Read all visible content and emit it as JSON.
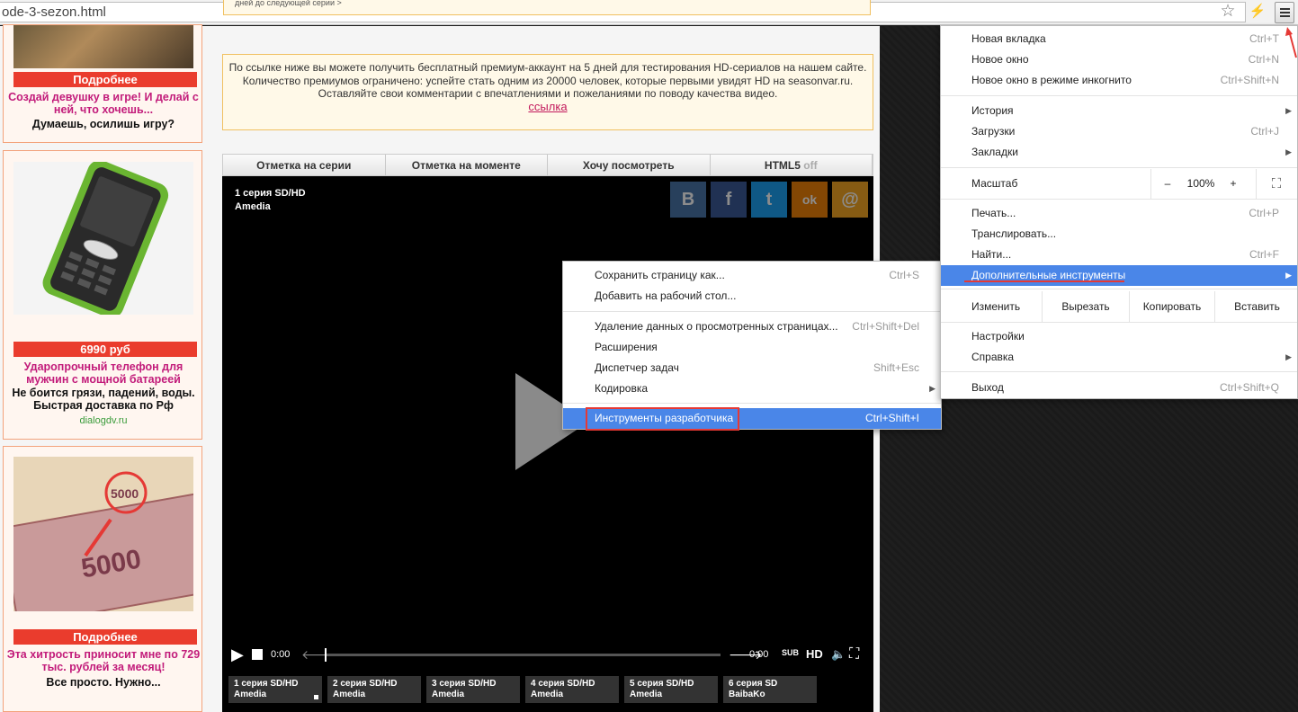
{
  "browser": {
    "url_fragment": "ode-3-sezon.html"
  },
  "ads": [
    {
      "button": "Подробнее",
      "line1": "Создай девушку в игре! И делай с ней, что хочешь...",
      "line2": "Думаешь, осилишь игру?"
    },
    {
      "price": "6990 руб",
      "line1": "Ударопрочный телефон для мужчин с мощной батареей",
      "line2": "Не боится грязи, падений, воды. Быстрая доставка по Рф",
      "domain": "dialogdv.ru"
    },
    {
      "button": "Подробнее",
      "line1": "Эта хитрость приносит мне по 729 тыс. рублей за месяц!",
      "line2": "Все просто. Нужно..."
    }
  ],
  "notice": {
    "top_cut": "дней до следующей серии >",
    "text": "По ссылке ниже вы можете получить бесплатный премиум-аккаунт на 5 дней для тестирования HD-сериалов на нашем сайте. Количество премиумов ограничено: успейте стать одним из 20000 человек, которые первыми увидят HD на seasonvar.ru.",
    "text2": "Оставляйте свои комментарии с впечатлениями и пожеланиями по поводу качества видео.",
    "link": "ссылка"
  },
  "player_tabs": [
    "Отметка на серии",
    "Отметка на моменте",
    "Хочу посмотреть",
    "HTML5"
  ],
  "player_tab_off": "off",
  "player": {
    "title1": "1 серия SD/HD",
    "title2": "Amedia",
    "time_current": "0:00",
    "time_total": "0:00",
    "sub": "SUB",
    "hd": "HD",
    "social": [
      "В",
      "f",
      "t",
      "ok",
      "@"
    ],
    "episodes": [
      {
        "title": "1 серия SD/HD",
        "studio": "Amedia"
      },
      {
        "title": "2 серия SD/HD",
        "studio": "Amedia"
      },
      {
        "title": "3 серия SD/HD",
        "studio": "Amedia"
      },
      {
        "title": "4 серия SD/HD",
        "studio": "Amedia"
      },
      {
        "title": "5 серия SD/HD",
        "studio": "Amedia"
      },
      {
        "title": "6 серия SD",
        "studio": "BaibaKo"
      }
    ]
  },
  "submenu": {
    "save": {
      "label": "Сохранить страницу как...",
      "shortcut": "Ctrl+S"
    },
    "desktop": {
      "label": "Добавить на рабочий стол..."
    },
    "clear": {
      "label": "Удаление данных о просмотренных страницах...",
      "shortcut": "Ctrl+Shift+Del"
    },
    "ext": {
      "label": "Расширения"
    },
    "tasks": {
      "label": "Диспетчер задач",
      "shortcut": "Shift+Esc"
    },
    "encoding": {
      "label": "Кодировка"
    },
    "devtools": {
      "label": "Инструменты разработчика",
      "shortcut": "Ctrl+Shift+I"
    }
  },
  "mainmenu": {
    "new_tab": {
      "label": "Новая вкладка",
      "shortcut": "Ctrl+T"
    },
    "new_window": {
      "label": "Новое окно",
      "shortcut": "Ctrl+N"
    },
    "incognito": {
      "label": "Новое окно в режиме инкогнито",
      "shortcut": "Ctrl+Shift+N"
    },
    "history": {
      "label": "История"
    },
    "downloads": {
      "label": "Загрузки",
      "shortcut": "Ctrl+J"
    },
    "bookmarks": {
      "label": "Закладки"
    },
    "zoom": {
      "label": "Масштаб",
      "minus": "–",
      "value": "100%",
      "plus": "+"
    },
    "print": {
      "label": "Печать...",
      "shortcut": "Ctrl+P"
    },
    "cast": {
      "label": "Транслировать..."
    },
    "find": {
      "label": "Найти...",
      "shortcut": "Ctrl+F"
    },
    "more_tools": {
      "label": "Дополнительные инструменты"
    },
    "edit": {
      "label": "Изменить",
      "cut": "Вырезать",
      "copy": "Копировать",
      "paste": "Вставить"
    },
    "settings": {
      "label": "Настройки"
    },
    "help": {
      "label": "Справка"
    },
    "exit": {
      "label": "Выход",
      "shortcut": "Ctrl+Shift+Q"
    }
  },
  "colors": {
    "highlight": "#4a86e8",
    "annotation": "#e53935",
    "ad_red": "#ea3c2d",
    "ad_pink": "#c21b7a"
  }
}
